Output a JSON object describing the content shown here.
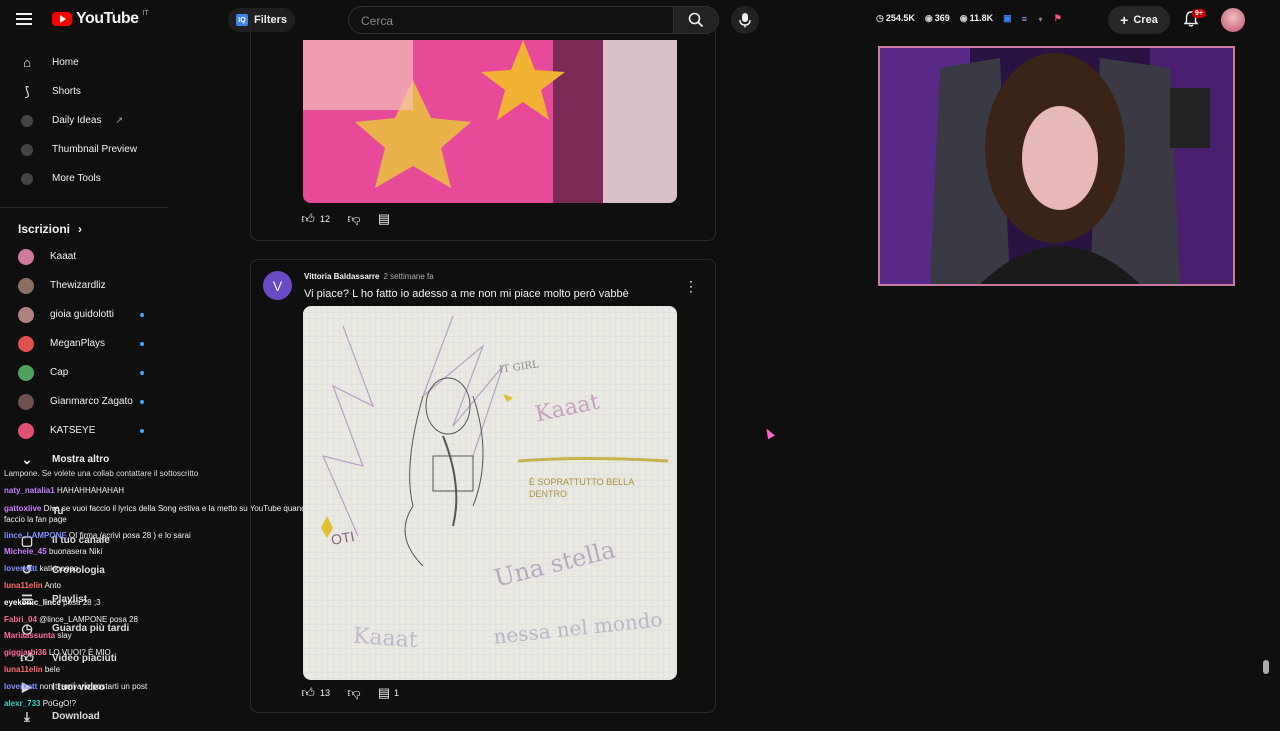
{
  "header": {
    "logo_text": "YouTube",
    "logo_country": "IT",
    "filters_label": "Filters",
    "search_placeholder": "Cerca",
    "stats": [
      {
        "icon": "clock-icon",
        "value": "254.5K"
      },
      {
        "icon": "eye-icon",
        "value": "369"
      },
      {
        "icon": "eye-icon",
        "value": "11.8K"
      }
    ],
    "create_label": "Crea",
    "notifications_badge": "9+"
  },
  "sidebar": {
    "items": [
      {
        "label": "Home",
        "icon": "home-icon"
      },
      {
        "label": "Shorts",
        "icon": "shorts-icon"
      },
      {
        "label": "Daily Ideas",
        "icon": "dot-icon",
        "external": "↗"
      },
      {
        "label": "Thumbnail Preview",
        "icon": "dot-icon"
      },
      {
        "label": "More Tools",
        "icon": "dot-icon"
      }
    ],
    "subscriptions_title": "Iscrizioni",
    "subscriptions": [
      {
        "name": "Kaaat",
        "color": "#d07aa0",
        "live": false
      },
      {
        "name": "Thewizardliz",
        "color": "#8a7060",
        "live": false
      },
      {
        "name": "gioia guidolotti",
        "color": "#b08080",
        "live": true
      },
      {
        "name": "MeganPlays",
        "color": "#e05050",
        "live": true
      },
      {
        "name": "Cap",
        "color": "#50a060",
        "live": true
      },
      {
        "name": "Gianmarco Zagato",
        "color": "#705050",
        "live": true
      },
      {
        "name": "KATSEYE",
        "color": "#e05070",
        "live": true
      }
    ],
    "show_more": "Mostra altro",
    "lower_items": [
      {
        "label": "Tu",
        "icon": "chevron-right-icon"
      },
      {
        "label": "Il tuo canale",
        "icon": "user-icon"
      },
      {
        "label": "Cronologia",
        "icon": "history-icon"
      },
      {
        "label": "Playlist",
        "icon": "playlist-icon"
      },
      {
        "label": "Guarda più tardi",
        "icon": "clock-icon"
      },
      {
        "label": "Video piaciuti",
        "icon": "thumb-up-icon"
      },
      {
        "label": "I tuoi video",
        "icon": "video-icon"
      },
      {
        "label": "Download",
        "icon": "download-icon"
      }
    ]
  },
  "chat": [
    {
      "user": "",
      "text": "Lampone. Se volete una collab contattare il sottoscritto",
      "color": "#dddddd"
    },
    {
      "user": "naty_natalia1",
      "text": "HAHAHHAHAHAH",
      "color": "#c77dff"
    },
    {
      "user": "gattoxlive",
      "text": "Diva se vuoi faccio il lyrics della Song estiva e la metto su YouTube quando faccio la fan page",
      "color": "#c77dff"
    },
    {
      "user": "lince_LAMPONE",
      "text": "OI firma (scrivi posa 28 ) e lo sarai",
      "color": "#7f8cff"
    },
    {
      "user": "Michele_45",
      "text": "buonasera Niki",
      "color": "#c77dff"
    },
    {
      "user": "loverkatt",
      "text": "katkiooooo",
      "color": "#7f8cff"
    },
    {
      "user": "luna11elin",
      "text": "Anto",
      "color": "#ff6b6b"
    },
    {
      "user": "eyekonic_lince",
      "text": "posa 28 ;3",
      "color": "#ffffff"
    },
    {
      "user": "Fabri_04",
      "text": "@lince_LAMPONE posa 28",
      "color": "#ff6b9a"
    },
    {
      "user": "Mariaassunta",
      "text": "slay",
      "color": "#ff6b9a"
    },
    {
      "user": "giggiarbi36",
      "text": "LO VUOI? È MIO",
      "color": "#ff6b9a"
    },
    {
      "user": "luna11elin",
      "text": "bele",
      "color": "#ff6b6b"
    },
    {
      "user": "loverkatt",
      "text": "non ti arrivano postarti un post",
      "color": "#7f8cff"
    },
    {
      "user": "alexr_733",
      "text": "PoGgO!?",
      "color": "#35d0c0"
    }
  ],
  "post1": {
    "likes": "12"
  },
  "post2": {
    "avatar_letter": "V",
    "author": "Vittoria Baldassarre",
    "time": "2 settimane fa",
    "text": "Vi piace? L ho fatto io adesso a me non mi piace molto però vabbè",
    "likes": "13",
    "replies": "1",
    "drawing_text": {
      "it_girl": "IT GIRL",
      "name": "Kaaat",
      "caption": "È SOPRATTUTTO BELLA DENTRO",
      "oti": "OTI",
      "phrase": "Una stella",
      "phrase2": "nessa nel mondo",
      "name2": "Kaaat"
    }
  }
}
